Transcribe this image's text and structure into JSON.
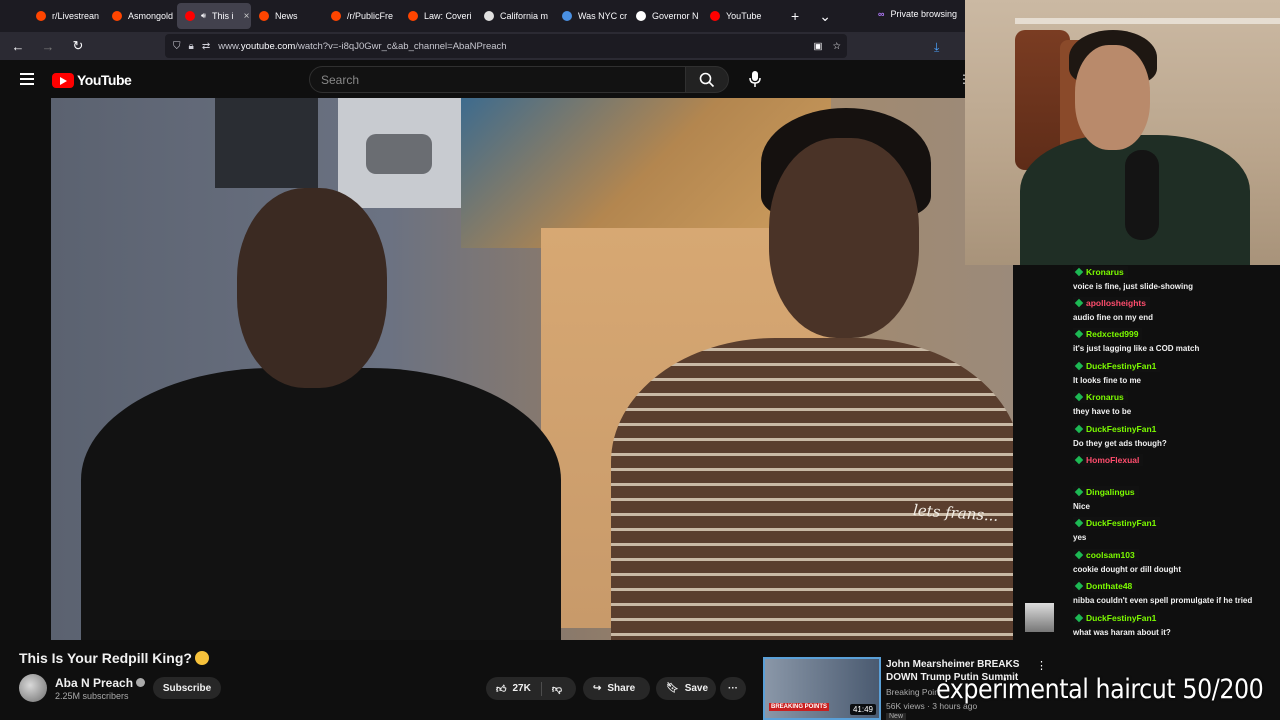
{
  "browser": {
    "tabs": [
      {
        "label": "r/Livestrean",
        "color": "#ff4500",
        "active": false
      },
      {
        "label": "Asmongold",
        "color": "#ff4500",
        "active": false
      },
      {
        "label": "This i",
        "color": "#ff0000",
        "active": true
      },
      {
        "label": "News",
        "color": "#ff4500",
        "active": false
      },
      {
        "label": "/r/PublicFre",
        "color": "#ff4500",
        "active": false
      },
      {
        "label": "Law: Coveri",
        "color": "#ff4500",
        "active": false
      },
      {
        "label": "California m",
        "color": "#e0e0e0",
        "active": false
      },
      {
        "label": "Was NYC cr",
        "color": "#4a90e2",
        "active": false
      },
      {
        "label": "Governor N",
        "color": "#ffffff",
        "active": false
      },
      {
        "label": "YouTube",
        "color": "#ff0000",
        "active": false
      }
    ],
    "private_label": "Private browsing",
    "url_prefix": "www.",
    "url_domain": "youtube.com",
    "url_path": "/watch?v=-i8qJ0Gwr_c&ab_channel=AbaNPreach"
  },
  "youtube": {
    "logo_text": "YouTube",
    "search_placeholder": "Search"
  },
  "video": {
    "title": "This Is Your Redpill King?",
    "shirt_text": "lets frans...",
    "channel_name": "Aba N Preach",
    "subscribers": "2.25M subscribers",
    "subscribe_label": "Subscribe",
    "likes": "27K",
    "share_label": "Share",
    "save_label": "Save"
  },
  "recommended": {
    "title": "John Mearsheimer BREAKS DOWN Trump Putin Summit",
    "channel": "Breaking Point",
    "meta": "56K views · 3 hours ago",
    "new_badge": "New",
    "duration": "41:49",
    "thumb_tag": "BREAKING POINTS"
  },
  "chat": [
    {
      "user": "Kronarus",
      "color": "#7cfc00",
      "text": "voice is fine, just slide-showing"
    },
    {
      "user": "apollosheights",
      "color": "#ff4d6d",
      "text": "audio fine on my end"
    },
    {
      "user": "Redxcted999",
      "color": "#7cfc00",
      "text": "it's just lagging like a COD match"
    },
    {
      "user": "DuckFestinyFan1",
      "color": "#7cfc00",
      "text": "It looks fine to me"
    },
    {
      "user": "Kronarus",
      "color": "#7cfc00",
      "text": "they have to be"
    },
    {
      "user": "DuckFestinyFan1",
      "color": "#7cfc00",
      "text": "Do they get ads though?"
    },
    {
      "user": "HomoFlexual",
      "color": "#ff4d6d",
      "text": ""
    },
    {
      "user": "Dingalingus",
      "color": "#7cfc00",
      "text": "Nice"
    },
    {
      "user": "DuckFestinyFan1",
      "color": "#7cfc00",
      "text": "yes"
    },
    {
      "user": "coolsam103",
      "color": "#7cfc00",
      "text": "cookie dought or dill dought"
    },
    {
      "user": "Donthate48",
      "color": "#7cfc00",
      "text": "nibba couldn't even spell promulgate if he tried"
    },
    {
      "user": "DuckFestinyFan1",
      "color": "#7cfc00",
      "text": "what was haram about it?"
    }
  ],
  "overlay_caption": "experimental haircut 50/200"
}
